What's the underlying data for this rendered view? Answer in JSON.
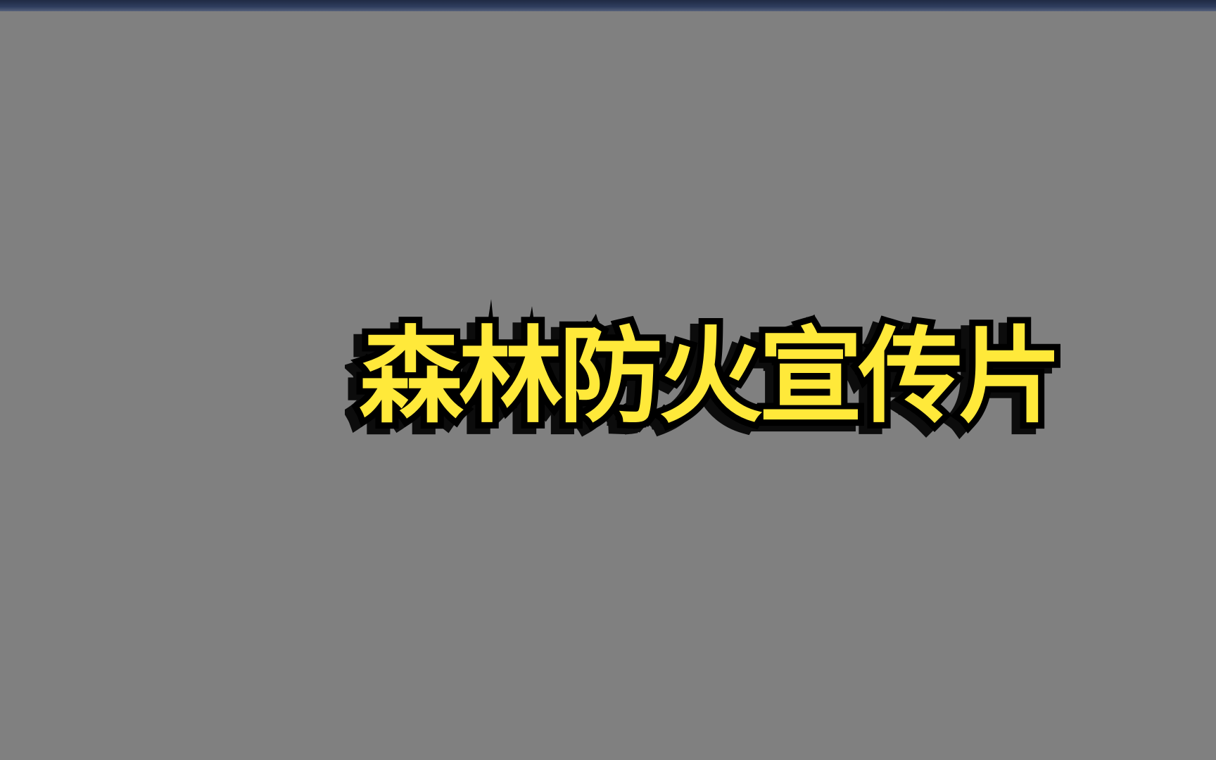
{
  "title": {
    "text": "森林防火宣传片",
    "fill_color": "#ffe93a",
    "stroke_color": "#000000"
  },
  "colors": {
    "background": "#808080",
    "top_bar": "#2f3d5e"
  }
}
